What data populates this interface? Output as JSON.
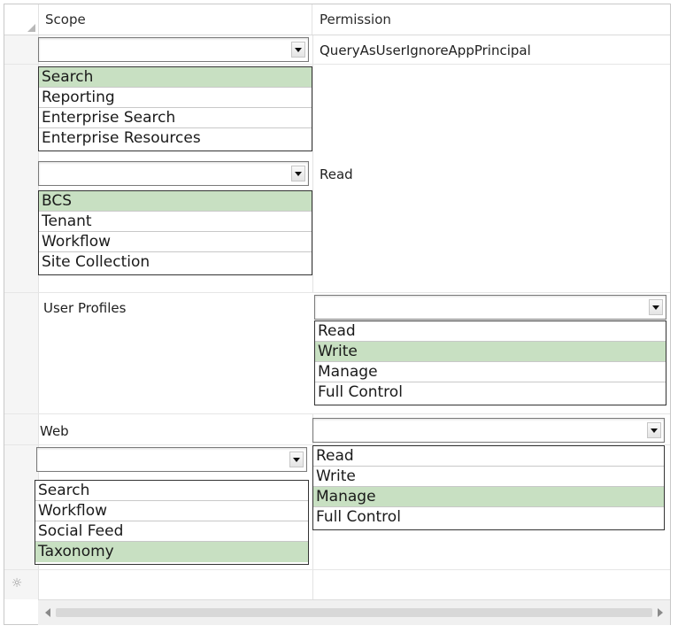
{
  "header": {
    "scope_label": "Scope",
    "permission_label": "Permission"
  },
  "rows": [
    {
      "scope_combo_value": "",
      "scope_options": [
        "Search",
        "Reporting",
        "Enterprise Search",
        "Enterprise Resources"
      ],
      "scope_selected": "Search",
      "permission": "QueryAsUserIgnoreAppPrincipal"
    },
    {
      "scope_combo_value": "",
      "scope_options": [
        "BCS",
        "Tenant",
        "Workflow",
        "Site Collection"
      ],
      "scope_selected": "BCS",
      "permission": "Read"
    },
    {
      "scope": "User Profiles",
      "permission_combo_value": "",
      "permission_options": [
        "Read",
        "Write",
        "Manage",
        "Full Control"
      ],
      "permission_selected": "Write"
    },
    {
      "scope": "Web",
      "scope_combo_value": "",
      "scope_options": [
        "Search",
        "Workflow",
        "Social Feed",
        "Taxonomy"
      ],
      "scope_selected": "Taxonomy",
      "permission_combo_value": "",
      "permission_options": [
        "Read",
        "Write",
        "Manage",
        "Full Control"
      ],
      "permission_selected": "Manage"
    }
  ],
  "icons": {
    "new_row": "new-row-icon",
    "scroll_left": "scroll-left-arrow-icon",
    "scroll_right": "scroll-right-arrow-icon",
    "dropdown": "chevron-down-icon"
  },
  "colors": {
    "selected_item": "#c8e0c2",
    "border": "#c9c9c9"
  }
}
